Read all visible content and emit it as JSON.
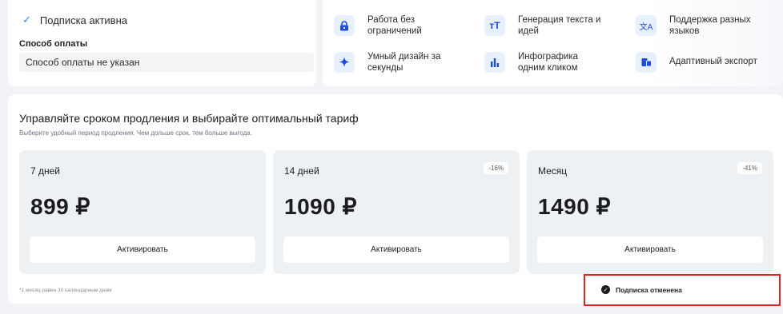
{
  "subscription": {
    "status": "Подписка активна",
    "payment_method_label": "Способ оплаты",
    "payment_method_value": "Способ оплаты не указан"
  },
  "features": [
    {
      "icon": "lock-icon",
      "glyph": "🔒",
      "label": "Работа без ограничений"
    },
    {
      "icon": "text-size-icon",
      "glyph": "тТ",
      "label": "Генерация текста и идей"
    },
    {
      "icon": "translate-icon",
      "glyph": "文A",
      "label": "Поддержка разных языков"
    },
    {
      "icon": "sparkle-icon",
      "glyph": "✦",
      "label": "Умный дизайн за секунды"
    },
    {
      "icon": "bar-chart-icon",
      "glyph": "▮",
      "label": "Инфографика одним кликом"
    },
    {
      "icon": "devices-icon",
      "glyph": "▤",
      "label": "Адаптивный экспорт"
    }
  ],
  "tariffs": {
    "title": "Управляйте сроком продления и выбирайте оптимальный тариф",
    "subtitle": "Выберите удобный период продления. Чем дольше срок, тем больше выгода.",
    "plans": [
      {
        "name": "7 дней",
        "price": "899 ₽",
        "discount": "",
        "button": "Активировать"
      },
      {
        "name": "14 дней",
        "price": "1090 ₽",
        "discount": "-16%",
        "button": "Активировать"
      },
      {
        "name": "Месяц",
        "price": "1490 ₽",
        "discount": "-41%",
        "button": "Активировать"
      }
    ],
    "footnote": "*1 месяц равен 30 календарным дням"
  },
  "toast": {
    "text": "Подписка отменена"
  },
  "colors": {
    "accent": "#1d4ed8",
    "check": "#3b82f6",
    "highlight_border": "#e02424"
  }
}
